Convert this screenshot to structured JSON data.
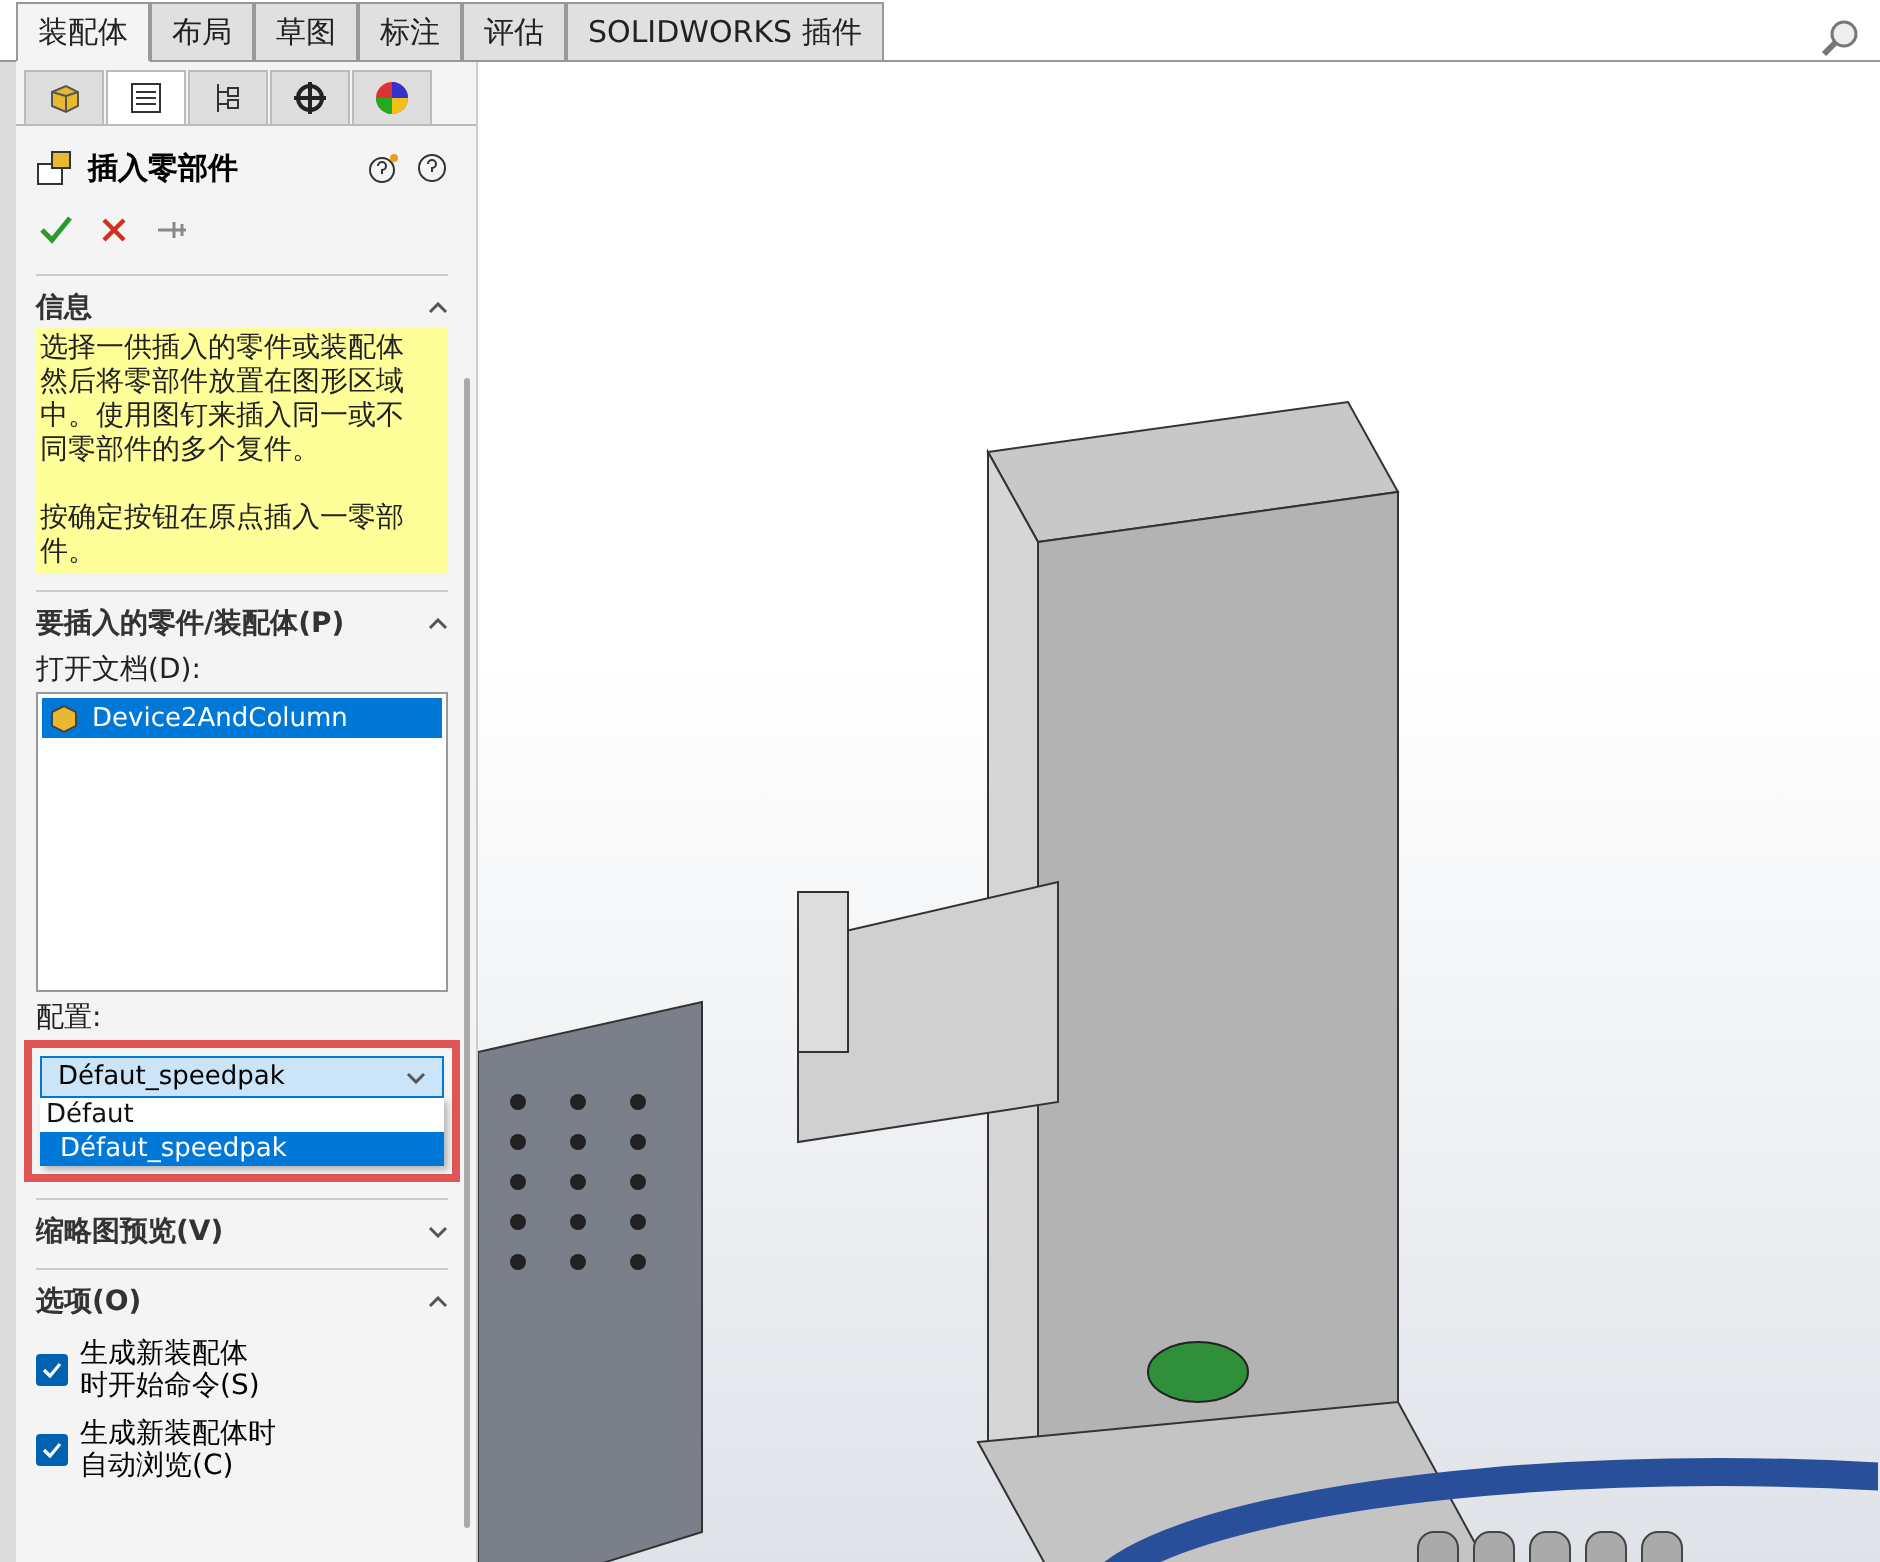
{
  "command_tabs": [
    {
      "label": "装配体",
      "selected": true
    },
    {
      "label": "布局",
      "selected": false
    },
    {
      "label": "草图",
      "selected": false
    },
    {
      "label": "标注",
      "selected": false
    },
    {
      "label": "评估",
      "selected": false
    },
    {
      "label": "SOLIDWORKS 插件",
      "selected": false
    }
  ],
  "panel_tabs": [
    {
      "kind": "feature",
      "selected": false
    },
    {
      "kind": "property",
      "selected": true
    },
    {
      "kind": "config",
      "selected": false
    },
    {
      "kind": "dim",
      "selected": false
    },
    {
      "kind": "display",
      "selected": false
    }
  ],
  "panel": {
    "title": "插入零部件"
  },
  "info_section": {
    "title": "信息",
    "expanded": true,
    "paragraphs": [
      "选择一供插入的零件或装配体然后将零部件放置在图形区域中。使用图钉来插入同一或不同零部件的多个复件。",
      "按确定按钮在原点插入一零部件。"
    ]
  },
  "part_section": {
    "title": "要插入的零件/装配体(P)",
    "expanded": true,
    "open_documents_label": "打开文档(D):",
    "documents": [
      {
        "name": "Device2AndColumn",
        "selected": true
      }
    ],
    "configuration_label": "配置:",
    "configuration": {
      "value": "Défaut_speedpak",
      "options": [
        {
          "label": "Défaut",
          "selected": false
        },
        {
          "label": "Défaut_speedpak",
          "selected": true
        }
      ]
    }
  },
  "thumbnail_section": {
    "title": "缩略图预览(V)",
    "expanded": false
  },
  "options_section": {
    "title": "选项(O)",
    "expanded": true,
    "checkboxes": [
      {
        "lines": [
          "生成新装配体",
          "时开始命令(S)"
        ],
        "checked": true
      },
      {
        "lines": [
          "生成新装配体时",
          "自动浏览(C)"
        ],
        "checked": true
      }
    ]
  }
}
